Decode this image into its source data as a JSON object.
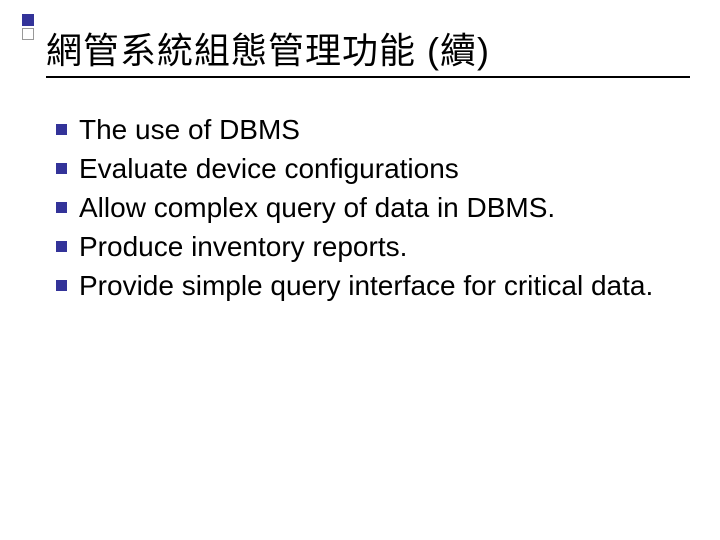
{
  "title": "網管系統組態管理功能 (續)",
  "bullets": [
    "The use of DBMS",
    "Evaluate device configurations",
    "Allow complex query of data in DBMS.",
    "Produce inventory reports.",
    "Provide simple query interface for critical data."
  ]
}
